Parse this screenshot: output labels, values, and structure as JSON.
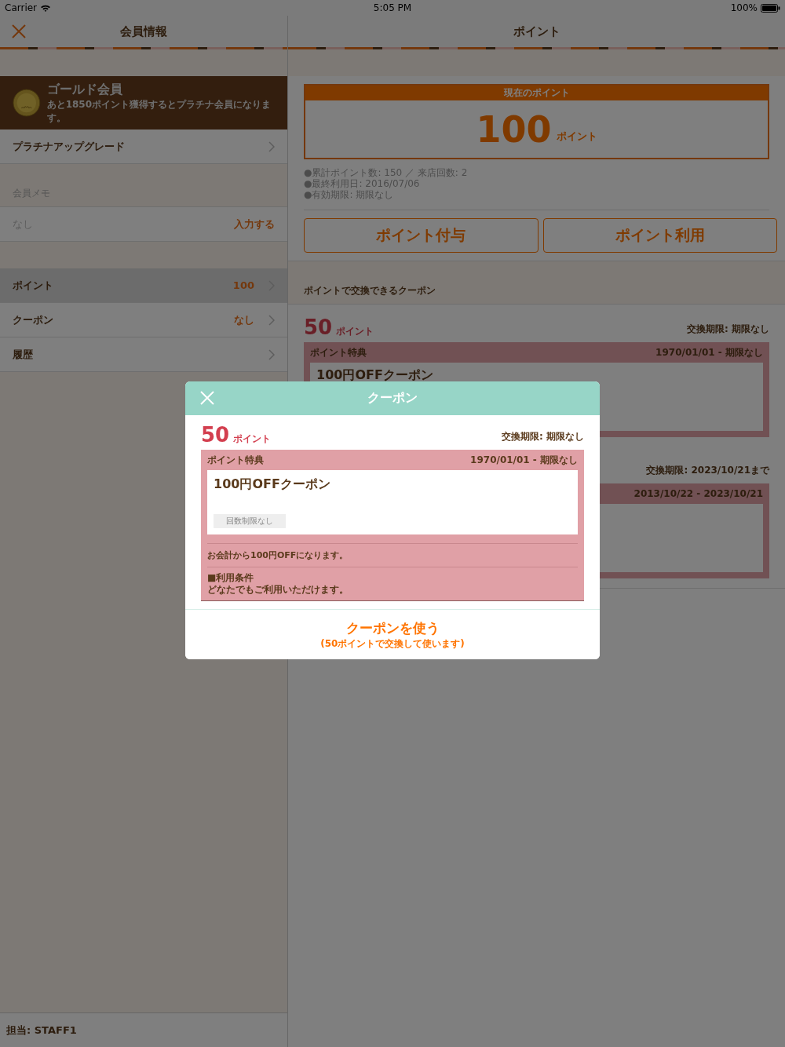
{
  "status_bar": {
    "carrier": "Carrier",
    "time": "5:05 PM",
    "battery": "100%"
  },
  "left": {
    "title": "会員情報",
    "member": {
      "rank": "ゴールド会員",
      "message": "あと1850ポイント獲得するとプラチナ会員になります。"
    },
    "upgrade": "プラチナアップグレード",
    "memo": {
      "header": "会員メモ",
      "value": "なし",
      "action": "入力する"
    },
    "menu": [
      {
        "label": "ポイント",
        "value": "100",
        "selected": true
      },
      {
        "label": "クーポン",
        "value": "なし",
        "selected": false
      },
      {
        "label": "履歴",
        "selected": false
      }
    ],
    "staff": "担当: STAFF1"
  },
  "right": {
    "title": "ポイント",
    "current_points": {
      "label": "現在のポイント",
      "value": "100",
      "unit": "ポイント"
    },
    "stats": [
      "●累計ポイント数: 150 ／ 来店回数: 2",
      "●最終利用日: 2016/07/06",
      "●有効期限: 期限なし"
    ],
    "buttons": [
      "ポイント付与",
      "ポイント利用"
    ],
    "section_title": "ポイントで交換できるクーポン",
    "coupons": [
      {
        "points": "50",
        "unit": "ポイント",
        "deadline": "交換期限: 期限なし",
        "category": "ポイント特典",
        "period": "1970/01/01 - 期限なし",
        "name": "100円OFFクーポン"
      },
      {
        "deadline": "交換期限: 2023/10/21まで",
        "period": "2013/10/22 - 2023/10/21"
      }
    ]
  },
  "modal": {
    "title": "クーポン",
    "points": "50",
    "unit": "ポイント",
    "deadline": "交換期限: 期限なし",
    "category": "ポイント特典",
    "period": "1970/01/01 - 期限なし",
    "name": "100円OFFクーポン",
    "limit": "回数制限なし",
    "description": "お会計から100円OFFになります。",
    "conditions_heading": "■利用条件",
    "conditions": "どなたでもご利用いただけます。",
    "action": "クーポンを使う",
    "action_note": "(50ポイントで交換して使います)"
  }
}
